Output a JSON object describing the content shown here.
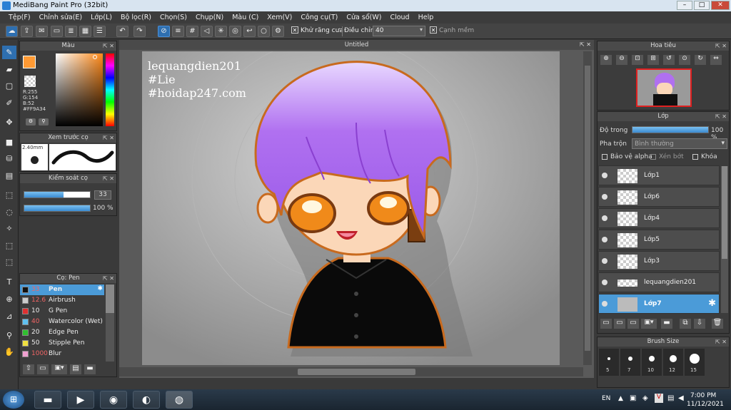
{
  "titlebar": {
    "title": "MediBang Paint Pro (32bit)"
  },
  "menu": [
    "Tệp(F)",
    "Chỉnh sửa(E)",
    "Lớp(L)",
    "Bộ lọc(R)",
    "Chọn(S)",
    "Chụp(N)",
    "Màu (C)",
    "Xem(V)",
    "Công cụ(T)",
    "Cửa sổ(W)",
    "Cloud",
    "Help"
  ],
  "toolbar": {
    "antialias_label": "Khử răng cưa",
    "adjust_label": "Điều chỉnh",
    "adjust_value": "40",
    "smooth_label": "Cạnh mềm"
  },
  "color_panel": {
    "title": "Màu",
    "r": "R:255",
    "g": "G:154",
    "b": "B:52",
    "hex": "#FF9A34",
    "primary": "#ff9a34"
  },
  "brush_preview": {
    "title": "Xem trước cọ",
    "size": "2.40mm"
  },
  "brush_control": {
    "title": "Kiểm soát cọ",
    "size_value": "33",
    "opacity_value": "100 %"
  },
  "brush_list": {
    "title": "Cọ: Pen",
    "items": [
      {
        "size": "33",
        "name": "Pen",
        "color": "#111111"
      },
      {
        "size": "12.6",
        "name": "Airbrush",
        "color": "#cccccc"
      },
      {
        "size": "10",
        "name": "G Pen",
        "color": "#e03030"
      },
      {
        "size": "40",
        "name": "Watercolor (Wet)",
        "color": "#60c0f0"
      },
      {
        "size": "20",
        "name": "Edge Pen",
        "color": "#30c030"
      },
      {
        "size": "50",
        "name": "Stipple Pen",
        "color": "#f0e040"
      },
      {
        "size": "1000",
        "name": "Blur",
        "color": "#f0a0d0"
      }
    ]
  },
  "canvas": {
    "tab_title": "Untitled",
    "watermark": [
      "lequangdien201",
      "#Lie",
      "#hoidap247.com"
    ]
  },
  "navigator": {
    "title": "Hoa tiêu"
  },
  "layers_panel": {
    "title": "Lớp",
    "opacity_label": "Độ trong",
    "opacity_value": "100 %",
    "opacity_fraction": 1.0,
    "blend_label": "Pha trộn",
    "blend_value": "Bình thường",
    "protect_alpha": "Bảo vệ alpha",
    "clip": "Xén bớt",
    "lock": "Khóa",
    "layers": [
      "Lớp1",
      "Lớp6",
      "Lớp4",
      "Lớp5",
      "Lớp3",
      "lequangdien201",
      "Lớp7"
    ],
    "selected": "Lớp7"
  },
  "brush_size_panel": {
    "title": "Brush Size",
    "sizes": [
      "5",
      "7",
      "10",
      "12",
      "15"
    ]
  },
  "taskbar": {
    "lang": "EN",
    "time": "7:00 PM",
    "date": "11/12/2021"
  }
}
